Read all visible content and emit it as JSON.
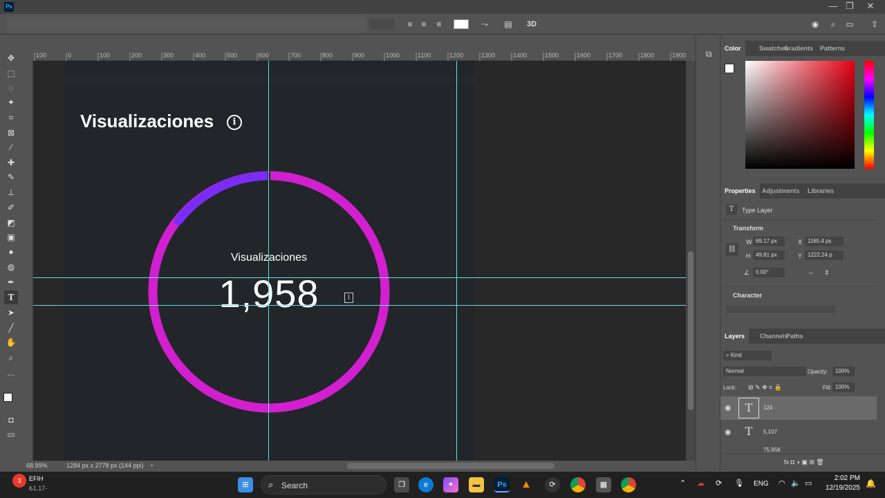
{
  "titlebar": {
    "app_icon": "Ps",
    "minimize": "—",
    "restore": "❐",
    "close": "✕"
  },
  "ruler_ticks": [
    "100",
    "0",
    "100",
    "200",
    "300",
    "400",
    "500",
    "600",
    "700",
    "800",
    "900",
    "1000",
    "1100",
    "1200",
    "1300",
    "1400",
    "1500",
    "1600",
    "1700",
    "1800",
    "1900"
  ],
  "canvas": {
    "heading": "Visualizaciones",
    "info_icon": "i",
    "gauge_label": "Visualizaciones",
    "gauge_value": "1,958",
    "gauge_colors": {
      "track": "#d21fd0",
      "segment": "#7a2cf5",
      "guide": "#62e3d8"
    }
  },
  "status": {
    "zoom": "68.99%",
    "doc_size": "1284 px x 2778 px (144 ppi)"
  },
  "color_panel": {
    "tabs": [
      "Color",
      "Swatches",
      "Gradients",
      "Patterns"
    ]
  },
  "properties_panel": {
    "tabs": [
      "Properties",
      "Adjustments",
      "Libraries"
    ],
    "layer_type": "Type Layer",
    "transform_label": "Transform",
    "w": "69.17 px",
    "x": "1165.4 px",
    "h": "49.81 px",
    "y": "1222.24 p",
    "angle": "0.00°",
    "character_label": "Character"
  },
  "layers_panel": {
    "tabs": [
      "Layers",
      "Channels",
      "Paths"
    ],
    "filter": "Kind",
    "blend_mode": "Normal",
    "opacity_label": "Opacity:",
    "opacity": "100%",
    "lock_label": "Lock:",
    "fill_label": "Fill:",
    "fill": "100%",
    "layers": [
      {
        "name": "124",
        "selected": true
      },
      {
        "name": "5,107",
        "selected": false
      },
      {
        "name": "75,958",
        "selected": false
      }
    ]
  },
  "taskbar": {
    "left_app": "EFIH",
    "left_sub": "₺1,17-",
    "search": "Search",
    "lang": "ENG",
    "time": "2:02 PM",
    "date": "12/19/2025"
  }
}
